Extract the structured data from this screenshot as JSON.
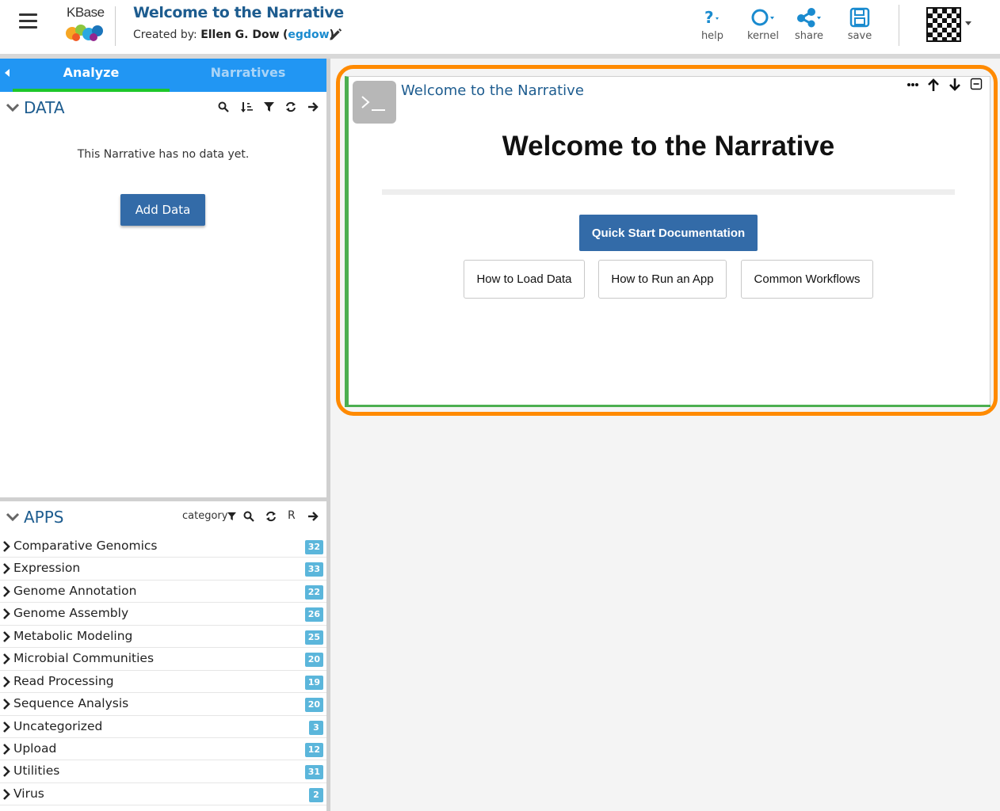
{
  "header": {
    "logo_text": "KBase",
    "narrative_title": "Welcome to the Narrative",
    "created_prefix": "Created by:",
    "author_name": "Ellen G. Dow",
    "username": "egdow",
    "buttons": [
      {
        "label": "help",
        "icon": "help-icon"
      },
      {
        "label": "kernel",
        "icon": "kernel-icon"
      },
      {
        "label": "share",
        "icon": "share-icon"
      },
      {
        "label": "save",
        "icon": "save-icon"
      }
    ]
  },
  "sidebar": {
    "tabs": [
      {
        "label": "Analyze",
        "active": true
      },
      {
        "label": "Narratives",
        "active": false
      }
    ],
    "data": {
      "title": "DATA",
      "empty_message": "This Narrative has no data yet.",
      "add_button": "Add Data"
    },
    "apps": {
      "title": "APPS",
      "filter_label": "category",
      "r_label": "R",
      "categories": [
        {
          "label": "Comparative Genomics",
          "count": "32"
        },
        {
          "label": "Expression",
          "count": "33"
        },
        {
          "label": "Genome Annotation",
          "count": "22"
        },
        {
          "label": "Genome Assembly",
          "count": "26"
        },
        {
          "label": "Metabolic Modeling",
          "count": "25"
        },
        {
          "label": "Microbial Communities",
          "count": "20"
        },
        {
          "label": "Read Processing",
          "count": "19"
        },
        {
          "label": "Sequence Analysis",
          "count": "20"
        },
        {
          "label": "Uncategorized",
          "count": "3"
        },
        {
          "label": "Upload",
          "count": "12"
        },
        {
          "label": "Utilities",
          "count": "31"
        },
        {
          "label": "Virus",
          "count": "2"
        }
      ]
    }
  },
  "cell": {
    "title": "Welcome to the Narrative",
    "heading": "Welcome to the Narrative",
    "primary_button": "Quick Start Documentation",
    "links": [
      "How to Load Data",
      "How to Run an App",
      "Common Workflows"
    ]
  },
  "colors": {
    "brand_blue": "#1d5c8f",
    "tab_blue": "#2196f3",
    "button_blue": "#336ba8",
    "highlight_orange": "#ff8a00",
    "cell_green": "#4caf50",
    "badge_blue": "#5bb6db"
  }
}
